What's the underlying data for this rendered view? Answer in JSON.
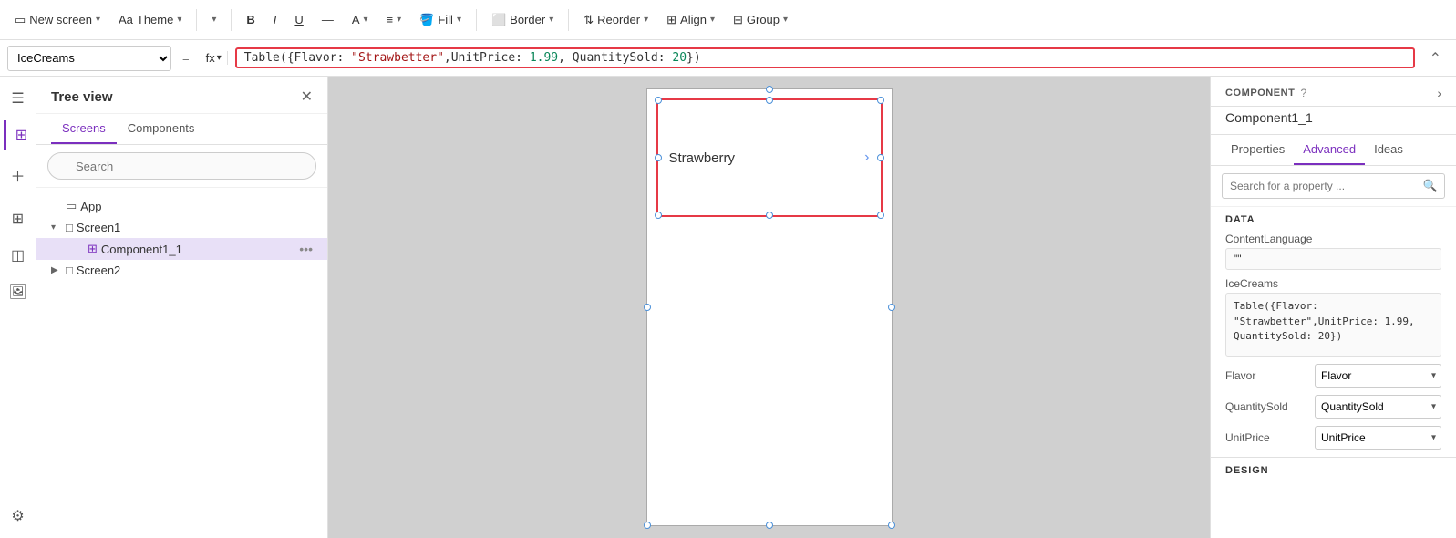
{
  "app_title": "New screen",
  "theme_label": "Theme",
  "toolbar": {
    "bold": "B",
    "italic": "I",
    "underline": "U",
    "fill_label": "Fill",
    "border_label": "Border",
    "reorder_label": "Reorder",
    "align_label": "Align",
    "group_label": "Group"
  },
  "formula_bar": {
    "selected_item": "IceCreams",
    "fx_label": "fx",
    "formula": "Table({Flavor: \"Strawbetter\",UnitPrice: 1.99, QuantitySold: 20})",
    "formula_parts": [
      {
        "text": "Table({Flavor: ",
        "type": "plain"
      },
      {
        "text": "\"Strawbetter\"",
        "type": "string"
      },
      {
        "text": ",UnitPrice: ",
        "type": "plain"
      },
      {
        "text": "1.99",
        "type": "number"
      },
      {
        "text": ", QuantitySold: ",
        "type": "plain"
      },
      {
        "text": "20",
        "type": "number"
      },
      {
        "text": "})",
        "type": "plain"
      }
    ]
  },
  "tree_view": {
    "title": "Tree view",
    "tabs": [
      "Screens",
      "Components"
    ],
    "active_tab": "Screens",
    "search_placeholder": "Search",
    "items": [
      {
        "type": "app",
        "label": "App",
        "icon": "app"
      },
      {
        "type": "screen",
        "label": "Screen1",
        "expanded": true,
        "children": [
          {
            "type": "component",
            "label": "Component1_1",
            "selected": true
          }
        ]
      },
      {
        "type": "screen",
        "label": "Screen2",
        "expanded": false
      }
    ]
  },
  "canvas": {
    "component_text": "Strawberry"
  },
  "right_panel": {
    "component_label": "COMPONENT",
    "component_name": "Component1_1",
    "tabs": [
      "Properties",
      "Advanced",
      "Ideas"
    ],
    "active_tab": "Advanced",
    "search_placeholder": "Search for a property ...",
    "sections": {
      "data": {
        "title": "DATA",
        "fields": [
          {
            "label": "ContentLanguage",
            "value": "\"\"",
            "type": "text"
          },
          {
            "label": "IceCreams",
            "value": "Table({Flavor:\n\"Strawbetter\",UnitPrice: 1.99,\nQuantitySold: 20})",
            "type": "code"
          }
        ],
        "selects": [
          {
            "label": "Flavor",
            "value": "Flavor"
          },
          {
            "label": "QuantitySold",
            "value": "QuantitySold"
          },
          {
            "label": "UnitPrice",
            "value": "UnitPrice"
          }
        ]
      },
      "design": {
        "title": "DESIGN"
      }
    }
  }
}
